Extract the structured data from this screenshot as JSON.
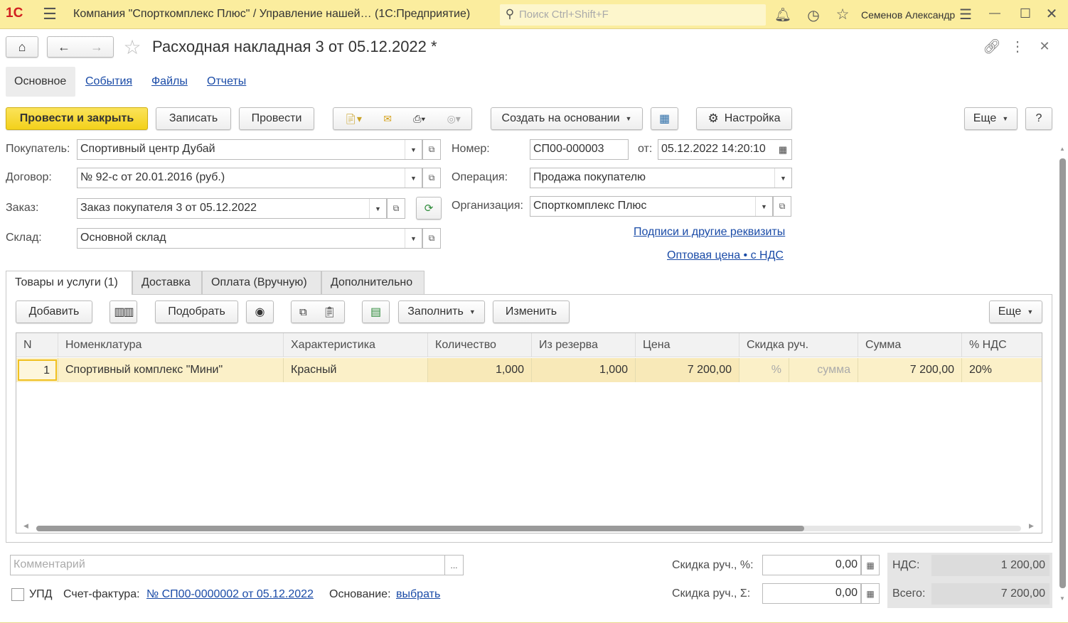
{
  "titlebar": {
    "logo": "1С",
    "title": "Компания \"Спорткомплекс Плюс\" / Управление нашей…  (1С:Предприятие)",
    "search_placeholder": "Поиск Ctrl+Shift+F",
    "user": "Семенов Александр"
  },
  "header": {
    "title": "Расходная накладная 3 от 05.12.2022 *"
  },
  "nav_tabs": [
    "Основное",
    "События",
    "Файлы",
    "Отчеты"
  ],
  "toolbar": {
    "post_close": "Провести и закрыть",
    "save": "Записать",
    "post": "Провести",
    "create_based": "Создать на основании",
    "settings": "Настройка",
    "more": "Еще",
    "help": "?"
  },
  "form": {
    "buyer_label": "Покупатель:",
    "buyer": "Спортивный центр Дубай",
    "contract_label": "Договор:",
    "contract": "№ 92-с от 20.01.2016 (руб.)",
    "order_label": "Заказ:",
    "order": "Заказ покупателя 3 от 05.12.2022",
    "warehouse_label": "Склад:",
    "warehouse": "Основной склад",
    "number_label": "Номер:",
    "number": "СП00-000003",
    "date_label": "от:",
    "date": "05.12.2022 14:20:10",
    "operation_label": "Операция:",
    "operation": "Продажа покупателю",
    "org_label": "Организация:",
    "org": "Спорткомплекс Плюс",
    "signatures_link": "Подписи и другие реквизиты",
    "price_link": "Оптовая цена • с НДС"
  },
  "doc_tabs": [
    "Товары и услуги (1)",
    "Доставка",
    "Оплата (Вручную)",
    "Дополнительно"
  ],
  "table_toolbar": {
    "add": "Добавить",
    "pick": "Подобрать",
    "fill": "Заполнить",
    "change": "Изменить",
    "more": "Еще"
  },
  "table": {
    "columns": [
      "N",
      "Номенклатура",
      "Характеристика",
      "Количество",
      "Из резерва",
      "Цена",
      "Скидка руч.",
      "Сумма",
      "% НДС"
    ],
    "rows": [
      {
        "n": "1",
        "item": "Спортивный комплекс \"Мини\"",
        "char": "Красный",
        "qty": "1,000",
        "reserve": "1,000",
        "price": "7 200,00",
        "disc_pct": "%",
        "disc_sum": "сумма",
        "sum": "7 200,00",
        "vat": "20%"
      }
    ]
  },
  "footer": {
    "comment_placeholder": "Комментарий",
    "comment_btn": "...",
    "upd_label": "УПД",
    "invoice_label": "Счет-фактура:",
    "invoice_link": "№ СП00-0000002 от 05.12.2022",
    "basis_label": "Основание:",
    "basis_link": "выбрать",
    "disc_pct_label": "Скидка руч., %:",
    "disc_pct": "0,00",
    "disc_sum_label": "Скидка руч., Σ:",
    "disc_sum": "0,00",
    "vat_label": "НДС:",
    "vat": "1 200,00",
    "total_label": "Всего:",
    "total": "7 200,00"
  }
}
